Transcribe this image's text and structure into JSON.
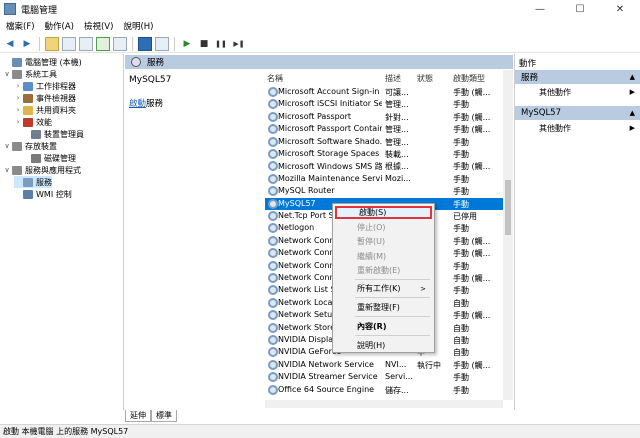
{
  "window": {
    "title": "電腦管理",
    "controls": {
      "minimize": "—",
      "maximize": "☐",
      "close": "✕"
    }
  },
  "menubar": [
    "檔案(F)",
    "動作(A)",
    "檢視(V)",
    "說明(H)"
  ],
  "toolbar": {
    "icons": [
      "back-arrow-icon",
      "forward-arrow-icon",
      "folder-up-icon",
      "show-hide-tree-icon",
      "properties-icon",
      "refresh-icon",
      "export-icon",
      "help-icon",
      "view-icon",
      "play-icon",
      "stop-icon",
      "pause-icon",
      "restart-icon"
    ],
    "glyphs": {
      "back": "◀",
      "forward": "▶",
      "play": "▶",
      "stop": "■",
      "pause": "❚❚",
      "restart": "▶❚"
    }
  },
  "tree": [
    {
      "label": "電腦管理 (本機)",
      "arrow": "",
      "color": "#6a8fb5"
    },
    {
      "label": "系統工具",
      "arrow": "∨",
      "color": "#8a8a8a"
    },
    {
      "label": "工作排程器",
      "arrow": "›",
      "color": "#5c8fc7"
    },
    {
      "label": "事件檢視器",
      "arrow": "›",
      "color": "#9b6f3c"
    },
    {
      "label": "共用資料夾",
      "arrow": "›",
      "color": "#e0b44a"
    },
    {
      "label": "效能",
      "arrow": "›",
      "color": "#c03a2b"
    },
    {
      "label": "裝置管理員",
      "arrow": "",
      "color": "#6f7f8f"
    },
    {
      "label": "存放裝置",
      "arrow": "∨",
      "color": "#8a8a8a"
    },
    {
      "label": "磁碟管理",
      "arrow": "",
      "color": "#7b7b7b"
    },
    {
      "label": "服務與應用程式",
      "arrow": "∨",
      "color": "#8a8a8a"
    },
    {
      "label": "服務",
      "arrow": "",
      "color": "#7a9cc0"
    },
    {
      "label": "WMI 控制",
      "arrow": "",
      "color": "#5c7fa7"
    }
  ],
  "tree_selected_index": 10,
  "center": {
    "header": "服務",
    "selected_service": "MySQL57",
    "start_link": "啟動",
    "start_link_suffix": "服務"
  },
  "columns": [
    "名稱",
    "描述",
    "狀態",
    "啟動類型"
  ],
  "services": [
    [
      "Microsoft Account Sign-in ...",
      "可讓...",
      "",
      "手動 (觸..."
    ],
    [
      "Microsoft iSCSI Initiator Ser...",
      "管理...",
      "",
      "手動"
    ],
    [
      "Microsoft Passport",
      "針對...",
      "",
      "手動 (觸..."
    ],
    [
      "Microsoft Passport Container",
      "管理...",
      "",
      "手動 (觸..."
    ],
    [
      "Microsoft Software Shado...",
      "管理...",
      "",
      "手動"
    ],
    [
      "Microsoft Storage Spaces S...",
      "裝載...",
      "",
      "手動"
    ],
    [
      "Microsoft Windows SMS 路...",
      "根據...",
      "",
      "手動 (觸..."
    ],
    [
      "Mozilla Maintenance Service",
      "Mozi...",
      "",
      "手動"
    ],
    [
      "MySQL Router",
      "",
      "",
      "手動"
    ],
    [
      "MySQL57",
      "",
      "",
      "手動"
    ],
    [
      "Net.Tcp Port Sh",
      "",
      "",
      "已停用"
    ],
    [
      "Netlogon",
      "",
      "",
      "手動"
    ],
    [
      "Network Conne",
      "",
      "",
      "手動 (觸..."
    ],
    [
      "Network Conne",
      "",
      "中",
      "手動 (觸..."
    ],
    [
      "Network Conne",
      "",
      "中",
      "手動"
    ],
    [
      "Network Conne",
      "",
      "中",
      "手動 (觸..."
    ],
    [
      "Network List Se",
      "",
      "中",
      "手動"
    ],
    [
      "Network Locatio",
      "",
      "中",
      "自動"
    ],
    [
      "Network Setup",
      "",
      "",
      "手動 (觸..."
    ],
    [
      "Network Store I",
      "",
      "中",
      "自動"
    ],
    [
      "NVIDIA Display",
      "",
      "中",
      "自動"
    ],
    [
      "NVIDIA GeForce",
      "",
      "中",
      "自動"
    ],
    [
      "NVIDIA Network Service",
      "NVI...",
      "執行中",
      "手動 (觸..."
    ],
    [
      "NVIDIA Streamer Service",
      "Servi...",
      "",
      "手動"
    ],
    [
      "Office 64 Source Engine",
      "儲存...",
      "",
      "手動"
    ]
  ],
  "selected_row_index": 9,
  "context_menu": {
    "items": [
      {
        "label": "啟動(S)",
        "state": "highlighted"
      },
      {
        "label": "停止(O)",
        "state": "disabled"
      },
      {
        "label": "暫停(U)",
        "state": "disabled"
      },
      {
        "label": "繼續(M)",
        "state": "disabled"
      },
      {
        "label": "重新啟動(E)",
        "state": "disabled"
      },
      {
        "label": "所有工作(K)",
        "state": "submenu",
        "submenu_glyph": ">"
      },
      {
        "label": "重新整理(F)",
        "state": "normal"
      },
      {
        "label": "內容(R)",
        "state": "bold"
      },
      {
        "label": "說明(H)",
        "state": "normal"
      }
    ],
    "highlight_color": "#e0343d"
  },
  "tabs": [
    "延伸",
    "標準"
  ],
  "actions": {
    "title": "動作",
    "groups": [
      {
        "header": "服務",
        "item": "其他動作"
      },
      {
        "header": "MySQL57",
        "item": "其他動作"
      }
    ],
    "collapse_glyph": "▲",
    "more_glyph": "▶"
  },
  "statusbar": "啟動 本機電腦 上的服務 MySQL57",
  "colors": {
    "accent": "#0078d7",
    "pane_header": "#b9cbe1",
    "tree_selection": "#cce8ff"
  }
}
